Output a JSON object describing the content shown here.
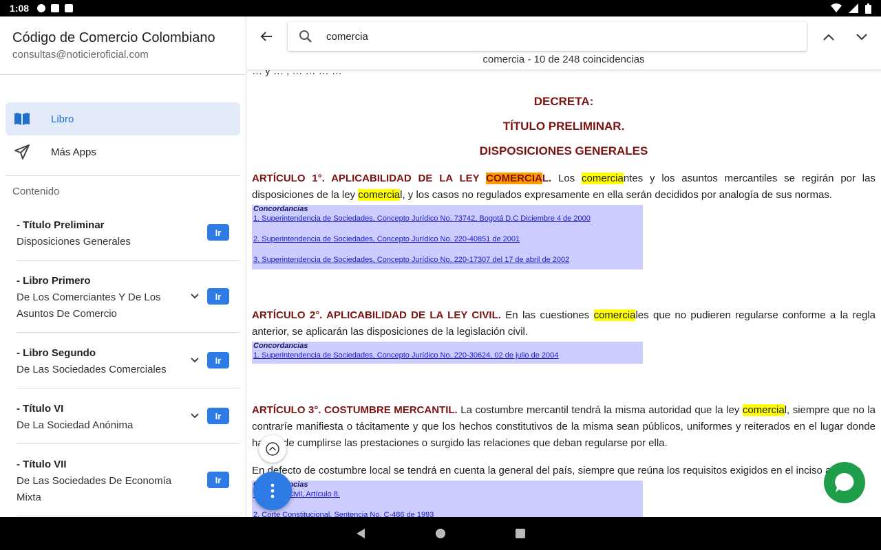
{
  "status_bar": {
    "time": "1:08"
  },
  "drawer": {
    "title": "Código de Comercio Colombiano",
    "email": "consultas@noticieroficial.com",
    "nav": [
      {
        "label": "Libro",
        "icon": "book-icon",
        "active": true
      },
      {
        "label": "Más Apps",
        "icon": "send-icon",
        "active": false
      }
    ],
    "section_label": "Contenido",
    "toc": [
      {
        "title": "- Título Preliminar",
        "subtitle": "Disposiciones Generales",
        "expandable": false,
        "button": "Ir"
      },
      {
        "title": "- Libro Primero",
        "subtitle": "De Los Comerciantes Y De Los Asuntos De Comercio",
        "expandable": true,
        "button": "Ir"
      },
      {
        "title": "- Libro Segundo",
        "subtitle": "De Las Sociedades Comerciales",
        "expandable": true,
        "button": "Ir"
      },
      {
        "title": "- Título VI",
        "subtitle": "De La Sociedad Anónima",
        "expandable": true,
        "button": "Ir"
      },
      {
        "title": "- Título VII",
        "subtitle": "De Las Sociedades De Economía Mixta",
        "expandable": false,
        "button": "Ir"
      }
    ]
  },
  "search": {
    "query": "comercia",
    "match_count": "comercia - 10 de 248 coincidencias"
  },
  "document": {
    "cut_line": "… y … , … … … …",
    "headings": [
      "DECRETA:",
      "TÍTULO PRELIMINAR.",
      "DISPOSICIONES GENERALES"
    ],
    "art1": {
      "title": "ARTÍCULO 1°. APLICABILIDAD DE LA LEY ",
      "title_hl": "COMERCIA",
      "title_tail": "L.",
      "t1": " Los ",
      "h1": "comercia",
      "t2": "ntes y los asuntos mercantiles se regirán por las disposiciones de la ley ",
      "h2": "comercia",
      "t3": "l, y los casos no regulados expresamente en ella serán decididos por analogía de sus normas.",
      "concord_label": "Concordancias",
      "links": [
        "1. Superintendencia de Sociedades, Concepto Jurídico No. 73742, Bogotá D.C Diciembre 4 de 2000",
        "2. Superintendencia de Sociedades, Concepto Jurídico No. 220-40851 de 2001",
        "3. Superintendencia de Sociedades, Concepto Jurídico No. 220-17307 del 17 de abril de 2002"
      ]
    },
    "art2": {
      "title": "ARTÍCULO 2°. APLICABILIDAD DE LA LEY CIVIL.",
      "t1": " En las cuestiones ",
      "h1": "comercia",
      "t2": "les que no pudieren regularse conforme a la regla anterior, se aplicarán las disposiciones de la legislación civil.",
      "concord_label": "Concordancias",
      "links": [
        "1. Superintendencia de Sociedades, Concepto Jurídico No. 220-30624, 02 de julio de 2004"
      ]
    },
    "art3": {
      "title": "ARTÍCULO 3°. COSTUMBRE MERCANTIL.",
      "t1": " La costumbre mercantil tendrá la misma autoridad que la ley ",
      "h1": "comercia",
      "t2": "l, siempre que no la contraríe manifiesta o tácitamente y que los hechos constitutivos de la misma sean públicos, uniformes y reiterados en el lugar donde hayan de cumplirse las prestaciones o surgido las relaciones que deban regularse por ella.",
      "p2": "En defecto de costumbre local se tendrá en cuenta la general del país, siempre que reúna los requisitos exigidos en el inciso anterior.",
      "concord_label": "Concordancias",
      "links": [
        "1. Código Civil, Artículo 8.",
        "2. Corte Constitucional, Sentencia No. C-486 de 1993"
      ]
    }
  },
  "colors": {
    "accent": "#2f7be6",
    "article_title": "#7a1212",
    "highlight": "#ffff00",
    "current_highlight": "#ff9900",
    "concordance_bg": "#ccccff",
    "chat": "#1e9e4a"
  }
}
